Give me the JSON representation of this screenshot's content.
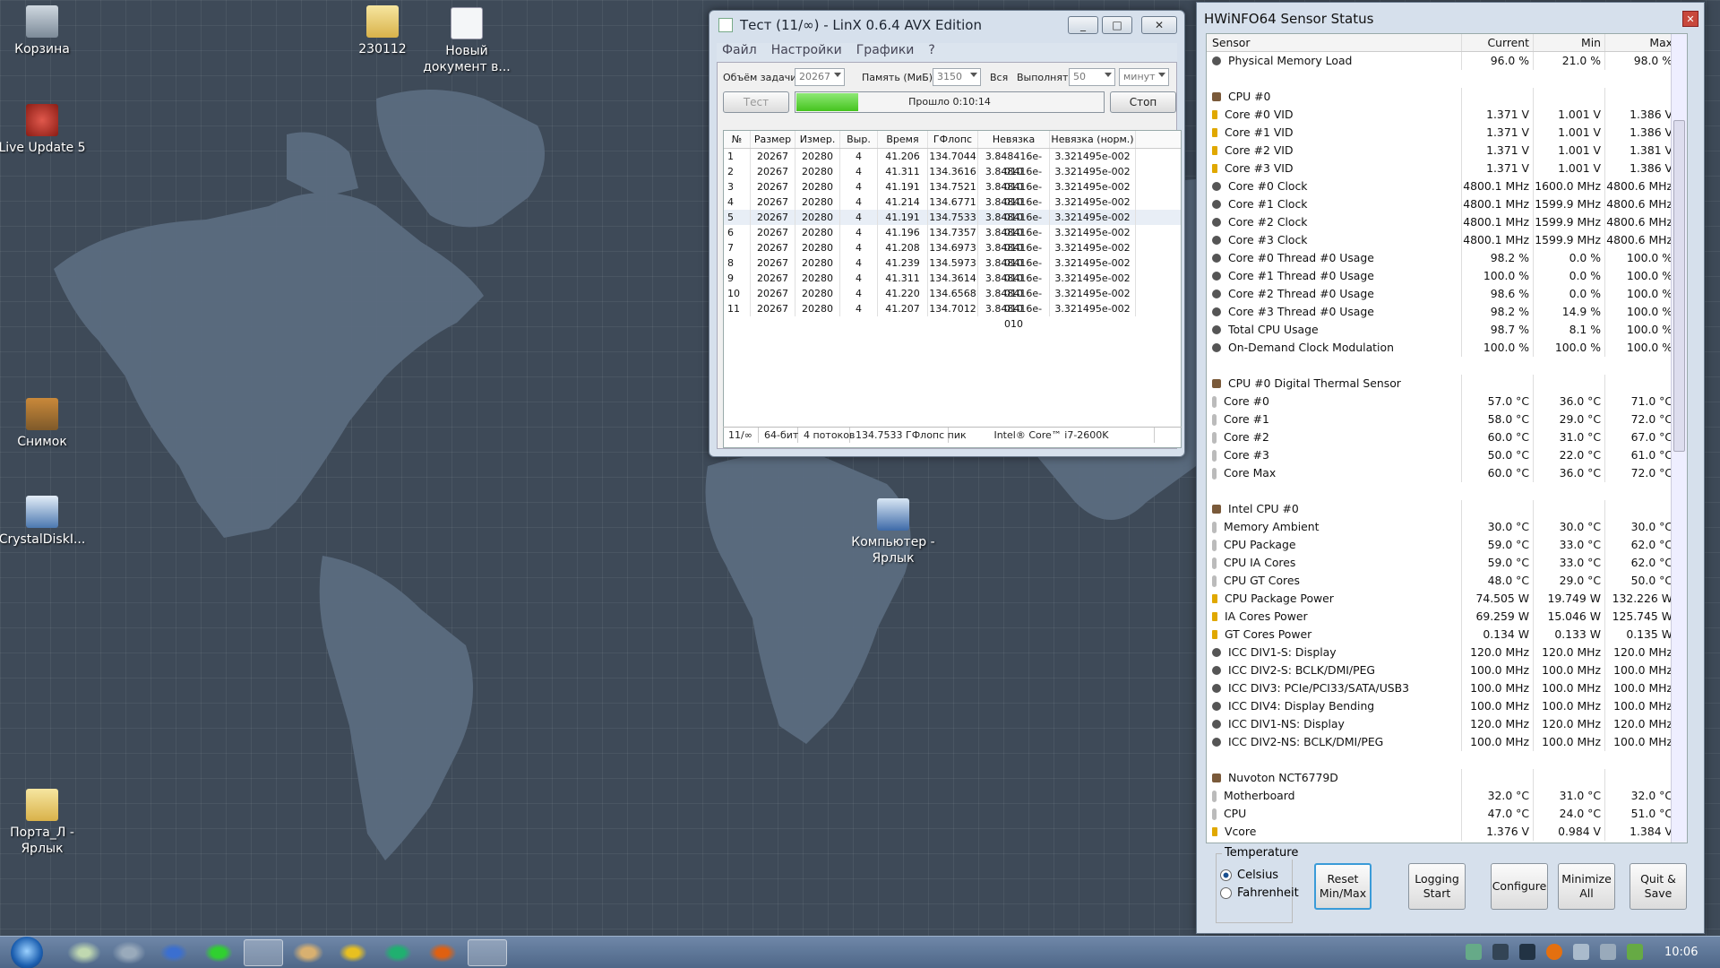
{
  "desktop": {
    "icons": [
      {
        "label": "Корзина"
      },
      {
        "label": "230112"
      },
      {
        "label": "Новый документ в..."
      },
      {
        "label": "Live Update 5"
      },
      {
        "label": "Снимок"
      },
      {
        "label": "CrystalDiskI..."
      },
      {
        "label": "Компьютер - Ярлык"
      },
      {
        "label": "Порта_Л - Ярлык"
      }
    ]
  },
  "linx": {
    "title": "Тест (11/∞) - LinX 0.6.4 AVX Edition",
    "menu": [
      "Файл",
      "Настройки",
      "Графики",
      "?"
    ],
    "task_size_label": "Объём задачи:",
    "task_size_value": "20267",
    "memory_label": "Память (МиБ):",
    "memory_value": "3150",
    "memory_all": "Вся",
    "run_label": "Выполнять:",
    "run_value": "50",
    "run_unit": "минут",
    "test_button": "Тест",
    "progress_label": "Прошло 0:10:14",
    "progress_fraction": 0.2,
    "stop_button": "Стоп",
    "columns": [
      "№",
      "Размер",
      "Измер.",
      "Выр.",
      "Время",
      "ГФлопс",
      "Невязка",
      "Невязка (норм.)"
    ],
    "rows": [
      [
        "1",
        "20267",
        "20280",
        "4",
        "41.206",
        "134.7044",
        "3.848416e-010",
        "3.321495e-002"
      ],
      [
        "2",
        "20267",
        "20280",
        "4",
        "41.311",
        "134.3616",
        "3.848416e-010",
        "3.321495e-002"
      ],
      [
        "3",
        "20267",
        "20280",
        "4",
        "41.191",
        "134.7521",
        "3.848416e-010",
        "3.321495e-002"
      ],
      [
        "4",
        "20267",
        "20280",
        "4",
        "41.214",
        "134.6771",
        "3.848416e-010",
        "3.321495e-002"
      ],
      [
        "5",
        "20267",
        "20280",
        "4",
        "41.191",
        "134.7533",
        "3.848416e-010",
        "3.321495e-002"
      ],
      [
        "6",
        "20267",
        "20280",
        "4",
        "41.196",
        "134.7357",
        "3.848416e-010",
        "3.321495e-002"
      ],
      [
        "7",
        "20267",
        "20280",
        "4",
        "41.208",
        "134.6973",
        "3.848416e-010",
        "3.321495e-002"
      ],
      [
        "8",
        "20267",
        "20280",
        "4",
        "41.239",
        "134.5973",
        "3.848416e-010",
        "3.321495e-002"
      ],
      [
        "9",
        "20267",
        "20280",
        "4",
        "41.311",
        "134.3614",
        "3.848416e-010",
        "3.321495e-002"
      ],
      [
        "10",
        "20267",
        "20280",
        "4",
        "41.220",
        "134.6568",
        "3.848416e-010",
        "3.321495e-002"
      ],
      [
        "11",
        "20267",
        "20280",
        "4",
        "41.207",
        "134.7012",
        "3.848416e-010",
        "3.321495e-002"
      ]
    ],
    "status": [
      "11/∞",
      "64-бит",
      "4 потоков",
      "134.7533 ГФлопс пик",
      "Intel® Core™ i7-2600K"
    ]
  },
  "hwinfo": {
    "title": "HWiNFO64 Sensor Status",
    "columns": [
      "Sensor",
      "Current",
      "Min",
      "Max"
    ],
    "rows": [
      {
        "t": "s",
        "icon": "circle-icon",
        "name": "Physical Memory Load",
        "cur": "96.0 %",
        "min": "21.0 %",
        "max": "98.0 %"
      },
      {
        "t": "b"
      },
      {
        "t": "g",
        "name": "CPU #0"
      },
      {
        "t": "s",
        "icon": "bolt-icon",
        "name": "Core #0 VID",
        "cur": "1.371 V",
        "min": "1.001 V",
        "max": "1.386 V"
      },
      {
        "t": "s",
        "icon": "bolt-icon",
        "name": "Core #1 VID",
        "cur": "1.371 V",
        "min": "1.001 V",
        "max": "1.386 V"
      },
      {
        "t": "s",
        "icon": "bolt-icon",
        "name": "Core #2 VID",
        "cur": "1.371 V",
        "min": "1.001 V",
        "max": "1.381 V"
      },
      {
        "t": "s",
        "icon": "bolt-icon",
        "name": "Core #3 VID",
        "cur": "1.371 V",
        "min": "1.001 V",
        "max": "1.386 V"
      },
      {
        "t": "s",
        "icon": "circle-icon",
        "name": "Core #0 Clock",
        "cur": "4800.1 MHz",
        "min": "1600.0 MHz",
        "max": "4800.6 MHz"
      },
      {
        "t": "s",
        "icon": "circle-icon",
        "name": "Core #1 Clock",
        "cur": "4800.1 MHz",
        "min": "1599.9 MHz",
        "max": "4800.6 MHz"
      },
      {
        "t": "s",
        "icon": "circle-icon",
        "name": "Core #2 Clock",
        "cur": "4800.1 MHz",
        "min": "1599.9 MHz",
        "max": "4800.6 MHz"
      },
      {
        "t": "s",
        "icon": "circle-icon",
        "name": "Core #3 Clock",
        "cur": "4800.1 MHz",
        "min": "1599.9 MHz",
        "max": "4800.6 MHz"
      },
      {
        "t": "s",
        "icon": "circle-icon",
        "name": "Core #0 Thread #0 Usage",
        "cur": "98.2 %",
        "min": "0.0 %",
        "max": "100.0 %"
      },
      {
        "t": "s",
        "icon": "circle-icon",
        "name": "Core #1 Thread #0 Usage",
        "cur": "100.0 %",
        "min": "0.0 %",
        "max": "100.0 %"
      },
      {
        "t": "s",
        "icon": "circle-icon",
        "name": "Core #2 Thread #0 Usage",
        "cur": "98.6 %",
        "min": "0.0 %",
        "max": "100.0 %"
      },
      {
        "t": "s",
        "icon": "circle-icon",
        "name": "Core #3 Thread #0 Usage",
        "cur": "98.2 %",
        "min": "14.9 %",
        "max": "100.0 %"
      },
      {
        "t": "s",
        "icon": "circle-icon",
        "name": "Total CPU Usage",
        "cur": "98.7 %",
        "min": "8.1 %",
        "max": "100.0 %"
      },
      {
        "t": "s",
        "icon": "circle-icon",
        "name": "On-Demand Clock Modulation",
        "cur": "100.0 %",
        "min": "100.0 %",
        "max": "100.0 %"
      },
      {
        "t": "b"
      },
      {
        "t": "g",
        "name": "CPU #0 Digital Thermal Sensor"
      },
      {
        "t": "s",
        "icon": "thermometer-icon",
        "name": "Core #0",
        "cur": "57.0 °C",
        "min": "36.0 °C",
        "max": "71.0 °C"
      },
      {
        "t": "s",
        "icon": "thermometer-icon",
        "name": "Core #1",
        "cur": "58.0 °C",
        "min": "29.0 °C",
        "max": "72.0 °C"
      },
      {
        "t": "s",
        "icon": "thermometer-icon",
        "name": "Core #2",
        "cur": "60.0 °C",
        "min": "31.0 °C",
        "max": "67.0 °C"
      },
      {
        "t": "s",
        "icon": "thermometer-icon",
        "name": "Core #3",
        "cur": "50.0 °C",
        "min": "22.0 °C",
        "max": "61.0 °C"
      },
      {
        "t": "s",
        "icon": "thermometer-icon",
        "name": "Core Max",
        "cur": "60.0 °C",
        "min": "36.0 °C",
        "max": "72.0 °C"
      },
      {
        "t": "b"
      },
      {
        "t": "g",
        "name": "Intel CPU #0"
      },
      {
        "t": "s",
        "icon": "thermometer-icon",
        "name": "Memory Ambient",
        "cur": "30.0 °C",
        "min": "30.0 °C",
        "max": "30.0 °C"
      },
      {
        "t": "s",
        "icon": "thermometer-icon",
        "name": "CPU Package",
        "cur": "59.0 °C",
        "min": "33.0 °C",
        "max": "62.0 °C"
      },
      {
        "t": "s",
        "icon": "thermometer-icon",
        "name": "CPU IA Cores",
        "cur": "59.0 °C",
        "min": "33.0 °C",
        "max": "62.0 °C"
      },
      {
        "t": "s",
        "icon": "thermometer-icon",
        "name": "CPU GT Cores",
        "cur": "48.0 °C",
        "min": "29.0 °C",
        "max": "50.0 °C"
      },
      {
        "t": "s",
        "icon": "bolt-icon",
        "name": "CPU Package Power",
        "cur": "74.505 W",
        "min": "19.749 W",
        "max": "132.226 W"
      },
      {
        "t": "s",
        "icon": "bolt-icon",
        "name": "IA Cores Power",
        "cur": "69.259 W",
        "min": "15.046 W",
        "max": "125.745 W"
      },
      {
        "t": "s",
        "icon": "bolt-icon",
        "name": "GT Cores Power",
        "cur": "0.134 W",
        "min": "0.133 W",
        "max": "0.135 W"
      },
      {
        "t": "s",
        "icon": "circle-icon",
        "name": "ICC DIV1-S: Display",
        "cur": "120.0 MHz",
        "min": "120.0 MHz",
        "max": "120.0 MHz"
      },
      {
        "t": "s",
        "icon": "circle-icon",
        "name": "ICC DIV2-S: BCLK/DMI/PEG",
        "cur": "100.0 MHz",
        "min": "100.0 MHz",
        "max": "100.0 MHz"
      },
      {
        "t": "s",
        "icon": "circle-icon",
        "name": "ICC DIV3: PCIe/PCI33/SATA/USB3",
        "cur": "100.0 MHz",
        "min": "100.0 MHz",
        "max": "100.0 MHz"
      },
      {
        "t": "s",
        "icon": "circle-icon",
        "name": "ICC DIV4: Display Bending",
        "cur": "100.0 MHz",
        "min": "100.0 MHz",
        "max": "100.0 MHz"
      },
      {
        "t": "s",
        "icon": "circle-icon",
        "name": "ICC DIV1-NS: Display",
        "cur": "120.0 MHz",
        "min": "120.0 MHz",
        "max": "120.0 MHz"
      },
      {
        "t": "s",
        "icon": "circle-icon",
        "name": "ICC DIV2-NS: BCLK/DMI/PEG",
        "cur": "100.0 MHz",
        "min": "100.0 MHz",
        "max": "100.0 MHz"
      },
      {
        "t": "b"
      },
      {
        "t": "g",
        "name": "Nuvoton NCT6779D"
      },
      {
        "t": "s",
        "icon": "thermometer-icon",
        "name": "Motherboard",
        "cur": "32.0 °C",
        "min": "31.0 °C",
        "max": "32.0 °C"
      },
      {
        "t": "s",
        "icon": "thermometer-icon",
        "name": "CPU",
        "cur": "47.0 °C",
        "min": "24.0 °C",
        "max": "51.0 °C"
      },
      {
        "t": "s",
        "icon": "bolt-icon",
        "name": "Vcore",
        "cur": "1.376 V",
        "min": "0.984 V",
        "max": "1.384 V"
      }
    ],
    "temperature_label": "Temperature",
    "celsius": "Celsius",
    "fahrenheit": "Fahrenheit",
    "buttons": [
      "Reset Min/Max",
      "Logging Start",
      "Configure",
      "Minimize All",
      "Quit & Save"
    ]
  },
  "taskbar": {
    "clock": "10:06",
    "apps": [
      "start-orb-icon",
      "disk-icon",
      "monitor-icon",
      "info-icon",
      "cpu-z-icon",
      "linx-icon",
      "hwinfo-icon",
      "k-icon",
      "g-icon",
      "burn-icon",
      "equalizer-icon"
    ]
  },
  "colors": {
    "progress": "#45c41e",
    "accent": "#3a7fcf"
  }
}
